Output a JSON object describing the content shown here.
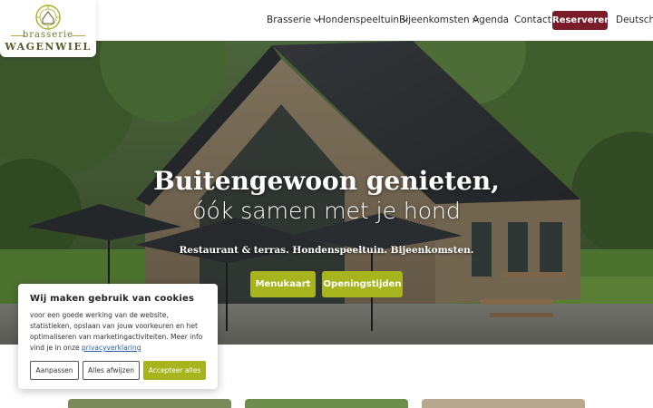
{
  "logo": {
    "line1": "brasserie",
    "line2": "WAGENWIEL"
  },
  "nav": {
    "items": [
      {
        "label": "Brasserie",
        "has_dropdown": true
      },
      {
        "label": "Hondenspeeltuin",
        "has_dropdown": true
      },
      {
        "label": "Bijeenkomsten",
        "has_dropdown": true
      },
      {
        "label": "Agenda",
        "has_dropdown": false
      },
      {
        "label": "Contact",
        "has_dropdown": false
      }
    ],
    "reserve_label": "Reserveren",
    "language_label": "Deutsch"
  },
  "hero": {
    "title": "Buitengewoon genieten,",
    "subtitle": "óók samen met je hond",
    "tagline": "Restaurant & terras. Hondenspeeltuin. Bijeenkomsten.",
    "buttons": [
      {
        "label": "Menukaart"
      },
      {
        "label": "Openingstijden"
      }
    ]
  },
  "cookie": {
    "title": "Wij maken gebruik van cookies",
    "body": "voor een goede werking van de website, statistieken, opslaan van jouw voorkeuren en het optimaliseren van marketingactiviteiten. Meer info vind je in onze",
    "link_label": "privacyverklaring",
    "buttons": {
      "customize": "Aanpassen",
      "reject": "Alles afwijzen",
      "accept": "Accepteer alles"
    }
  },
  "colors": {
    "brand_red": "#7a1c2a",
    "accent_green": "#a6b41e",
    "logo_olive": "#6b7a2a"
  }
}
